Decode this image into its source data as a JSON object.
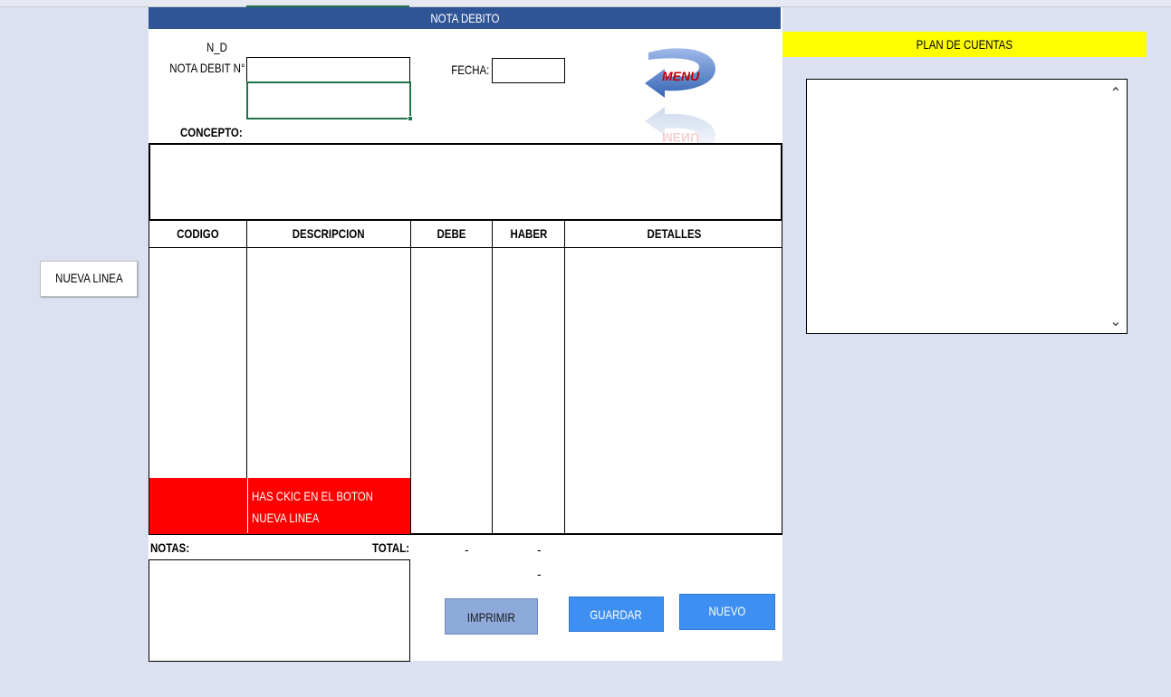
{
  "sheet": {
    "title": "NOTA DEBITO",
    "doc_code": "N_D",
    "nota_debit_label": "NOTA DEBIT N°",
    "fecha_label": "FECHA:",
    "concepto_label": "CONCEPTO:",
    "menu_label": "MENU"
  },
  "grid": {
    "columns": [
      "CODIGO",
      "DESCRIPCION",
      "DEBE",
      "HABER",
      "DETALLES"
    ],
    "hint_line1": "HAS CKIC EN EL  BOTON",
    "hint_line2": "NUEVA LINEA",
    "hint_color": "#ff0000"
  },
  "footer": {
    "notas_label": "NOTAS:",
    "total_label": "TOTAL:",
    "total_debe": "-",
    "total_haber": "-",
    "diff_value": "-"
  },
  "buttons": {
    "imprimir": "IMPRIMIR",
    "guardar": "GUARDAR",
    "nuevo": "NUEVO",
    "nueva_linea": "NUEVA LINEA"
  },
  "plan": {
    "title": "PLAN DE CUENTAS",
    "highlight_color": "#ffff00"
  },
  "colors": {
    "header_blue": "#2f5597",
    "button_blue": "#3d8ff2",
    "button_grey_blue": "#8eaadb",
    "background": "#dbe1f1"
  }
}
